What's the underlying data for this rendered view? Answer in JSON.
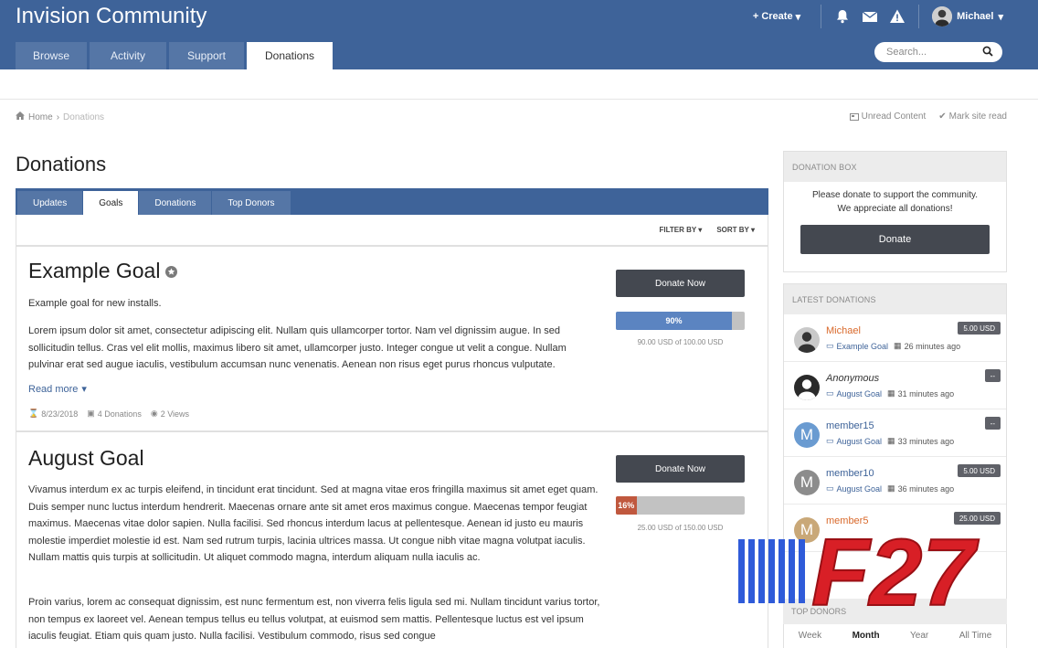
{
  "header": {
    "site_title": "Invision Community",
    "create_label": "Create",
    "user_name": "Michael",
    "nav": [
      "Browse",
      "Activity",
      "Support",
      "Donations"
    ],
    "active_nav": "Donations",
    "search_placeholder": "Search..."
  },
  "breadcrumb": {
    "home": "Home",
    "current": "Donations"
  },
  "crumb_actions": {
    "unread": "Unread Content",
    "mark_read": "Mark site read"
  },
  "page": {
    "title": "Donations"
  },
  "sub_tabs": [
    "Updates",
    "Goals",
    "Donations",
    "Top Donors"
  ],
  "filters": {
    "filter_by": "FILTER BY",
    "sort_by": "SORT BY"
  },
  "goals": [
    {
      "title": "Example Goal",
      "short_desc": "Example goal for new installs.",
      "desc": "Lorem ipsum dolor sit amet, consectetur adipiscing elit. Nullam quis ullamcorper tortor. Nam vel dignissim augue. In sed sollicitudin tellus. Cras vel elit mollis, maximus libero sit amet, ullamcorper justo. Integer congue ut velit a congue. Nullam pulvinar erat sed augue iaculis, vestibulum accumsan nunc venenatis. Aenean non risus eget purus rhoncus vulputate.",
      "read_more": "Read more",
      "date": "8/23/2018",
      "donations": "4 Donations",
      "views": "2 Views",
      "donate_label": "Donate Now",
      "progress_label": "90%",
      "progress_fraction": 0.9,
      "progress_text": "90.00 USD of 100.00 USD",
      "bar_color": "#5b84c1"
    },
    {
      "title": "August Goal",
      "desc1": "Vivamus interdum ex ac turpis eleifend, in tincidunt erat tincidunt. Sed at magna vitae eros fringilla maximus sit amet eget quam. Duis semper nunc luctus interdum hendrerit. Maecenas ornare ante sit amet eros maximus congue. Maecenas tempor feugiat maximus. Maecenas vitae dolor sapien. Nulla facilisi. Sed rhoncus interdum lacus at pellentesque. Aenean id justo eu mauris molestie imperdiet molestie id est. Nam sed rutrum turpis, lacinia ultrices massa. Ut congue nibh vitae magna volutpat iaculis. Nullam mattis quis turpis at sollicitudin. Ut aliquet commodo magna, interdum aliquam nulla iaculis ac.",
      "desc2": "Proin varius, lorem ac consequat dignissim, est nunc fermentum est, non viverra felis ligula sed mi. Nullam tincidunt varius tortor, non tempus ex laoreet vel. Aenean tempus tellus eu tellus volutpat, at euismod sem mattis. Pellentesque luctus est vel ipsum iaculis feugiat. Etiam quis quam justo. Nulla facilisi. Vestibulum commodo, risus sed congue",
      "donate_label": "Donate Now",
      "progress_label": "16%",
      "progress_fraction": 0.16,
      "progress_text": "25.00 USD of 150.00 USD",
      "bar_color": "#c0583e"
    }
  ],
  "donation_box": {
    "title": "DONATION BOX",
    "line1": "Please donate to support the community.",
    "line2": "We appreciate all donations!",
    "button": "Donate"
  },
  "latest": {
    "title": "LATEST DONATIONS",
    "items": [
      {
        "name": "Michael",
        "goal": "Example Goal",
        "time": "26 minutes ago",
        "amount": "5.00 USD",
        "initial": "",
        "avatar_color": "#c9c9c9",
        "name_color": "#d9692b"
      },
      {
        "name": "Anonymous",
        "goal": "August Goal",
        "time": "31 minutes ago",
        "amount": "--",
        "initial": "",
        "avatar_color": "#2a2a2a",
        "name_color": "#333333"
      },
      {
        "name": "member15",
        "goal": "August Goal",
        "time": "33 minutes ago",
        "amount": "--",
        "initial": "M",
        "avatar_color": "#6a9bd1",
        "name_color": "#3e6399"
      },
      {
        "name": "member10",
        "goal": "August Goal",
        "time": "36 minutes ago",
        "amount": "5.00 USD",
        "initial": "M",
        "avatar_color": "#8c8c8c",
        "name_color": "#3e6399"
      },
      {
        "name": "member5",
        "goal": "",
        "time": "",
        "amount": "25.00 USD",
        "initial": "M",
        "avatar_color": "#c9a878",
        "name_color": "#d9692b"
      }
    ]
  },
  "top_donors": {
    "title": "TOP DONORS",
    "tabs": [
      "Week",
      "Month",
      "Year",
      "All Time"
    ],
    "active": "Month"
  },
  "watermark": {
    "text": "F27"
  },
  "colors": {
    "brand": "#3e6399",
    "dark_button": "#444850"
  }
}
